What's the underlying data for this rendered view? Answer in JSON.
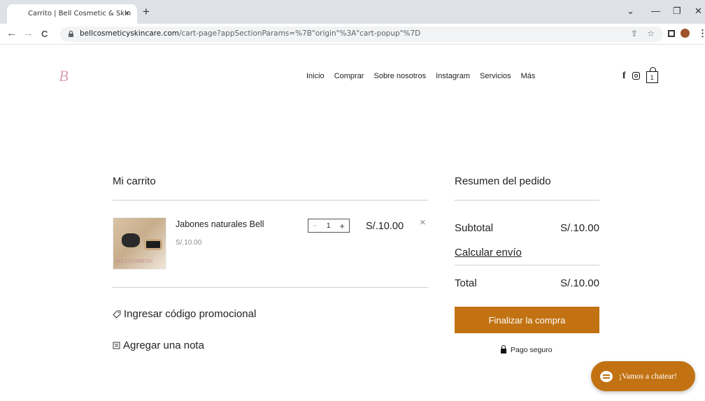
{
  "browser": {
    "tab_title": "Carrito | Bell Cosmetic & Skin",
    "tab_close": "×",
    "new_tab": "+",
    "url_domain": "bellcosmeticyskincare.com",
    "url_path": "/cart-page?appSectionParams=%7B\"origin\"%3A\"cart-popup\"%7D",
    "back": "←",
    "forward": "→",
    "reload": "C",
    "share_icon": "⇪",
    "star_icon": "☆",
    "minimize": "—",
    "maximize": "❐",
    "close": "✕",
    "chevron": "⌄",
    "menu": "⋮"
  },
  "site": {
    "logo_text": "B",
    "nav": [
      "Inicio",
      "Comprar",
      "Sobre nosotros",
      "Instagram",
      "Servicios",
      "Más"
    ],
    "facebook": "f",
    "cart_count": "1"
  },
  "cart": {
    "heading": "Mi carrito",
    "item": {
      "name": "Jabones naturales Bell",
      "unit_price": "S/.10.00",
      "quantity": "1",
      "total": "S/.10.00",
      "image_text": "BELL COSMETIC"
    },
    "minus": "−",
    "plus": "+",
    "remove": "×",
    "promo_label": "Ingresar código promocional",
    "note_label": "Agregar una nota"
  },
  "summary": {
    "heading": "Resumen del pedido",
    "subtotal_label": "Subtotal",
    "subtotal_value": "S/.10.00",
    "shipping_label": "Calcular envío",
    "total_label": "Total",
    "total_value": "S/.10.00",
    "checkout_label": "Finalizar la compra",
    "secure_label": "Pago seguro"
  },
  "chat": {
    "label": "¡Vamos a chatear!"
  },
  "colors": {
    "accent": "#c27212",
    "chrome": "#dee1e6"
  }
}
